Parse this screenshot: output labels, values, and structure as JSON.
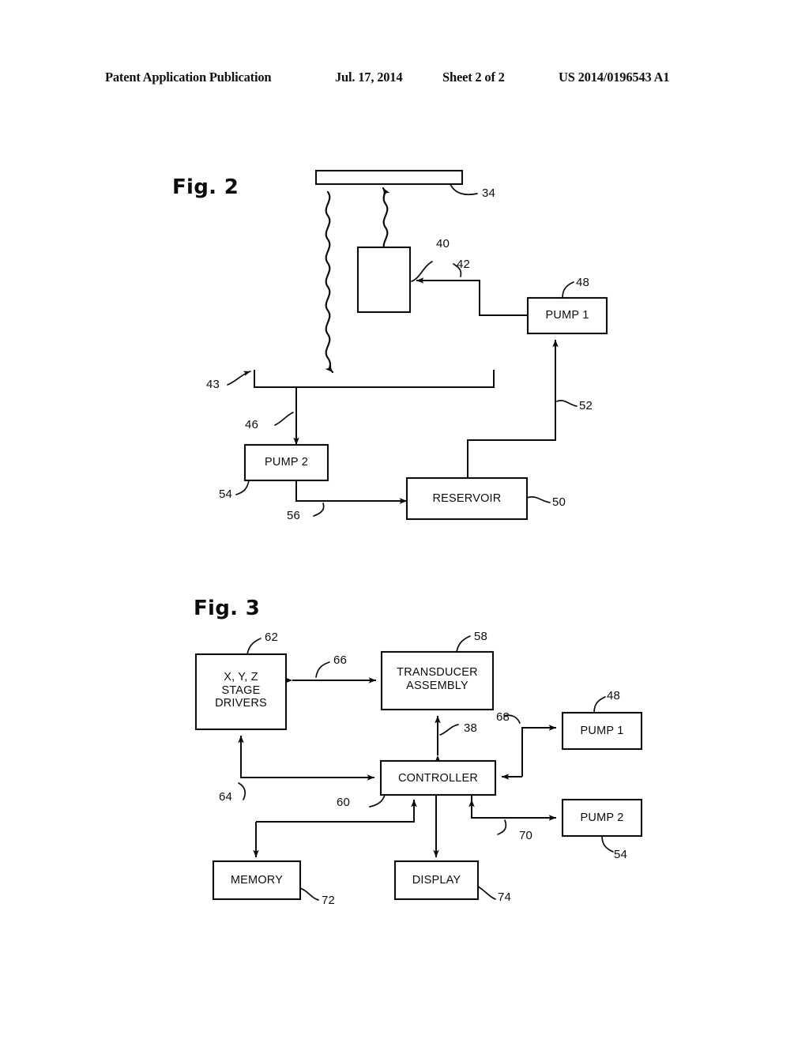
{
  "page": {
    "header": {
      "publication": "Patent Application Publication",
      "date": "Jul. 17, 2014",
      "sheet": "Sheet 2 of 2",
      "document_number": "US 2014/0196543 A1"
    },
    "ink_color": "#0d0d0d",
    "background_color": "#ffffff"
  },
  "figures": [
    {
      "label": "Fig. 2",
      "boxes": [
        {
          "id": "plate",
          "text": "",
          "ref": "34"
        },
        {
          "id": "transducer",
          "text": "",
          "ref": "40"
        },
        {
          "id": "pump1",
          "text": "PUMP 1",
          "ref": "48"
        },
        {
          "id": "pump2",
          "text": "PUMP 2",
          "ref": "54"
        },
        {
          "id": "reservoir",
          "text": "RESERVOIR",
          "ref": "50"
        }
      ],
      "refs": [
        "34",
        "40",
        "42",
        "48",
        "43",
        "52",
        "46",
        "54",
        "56",
        "50"
      ]
    },
    {
      "label": "Fig. 3",
      "boxes": [
        {
          "id": "stage-drivers",
          "text": "X, Y, Z\nSTAGE\nDRIVERS",
          "ref": "62"
        },
        {
          "id": "transducer-assembly",
          "text": "TRANSDUCER\nASSEMBLY",
          "ref": "58"
        },
        {
          "id": "controller",
          "text": "CONTROLLER",
          "ref": "60"
        },
        {
          "id": "pump1",
          "text": "PUMP 1",
          "ref": "48"
        },
        {
          "id": "pump2",
          "text": "PUMP 2",
          "ref": "54"
        },
        {
          "id": "memory",
          "text": "MEMORY",
          "ref": "72"
        },
        {
          "id": "display",
          "text": "DISPLAY",
          "ref": "74"
        }
      ],
      "refs": [
        "62",
        "66",
        "58",
        "48",
        "38",
        "68",
        "64",
        "60",
        "70",
        "54",
        "72",
        "74"
      ]
    }
  ],
  "fig2": {
    "label": "Fig. 2",
    "plate_ref": "34",
    "transducer_ref": "40",
    "line42_ref": "42",
    "pump1_label": "PUMP 1",
    "pump1_ref": "48",
    "container_ref": "43",
    "line52_ref": "52",
    "line46_ref": "46",
    "pump2_label": "PUMP 2",
    "pump2_ref": "54",
    "line56_ref": "56",
    "reservoir_label": "RESERVOIR",
    "reservoir_ref": "50"
  },
  "fig3": {
    "label": "Fig. 3",
    "stage_drivers_label": "X, Y, Z\nSTAGE\nDRIVERS",
    "stage_drivers_ref": "62",
    "link66_ref": "66",
    "transducer_assembly_label": "TRANSDUCER\nASSEMBLY",
    "transducer_assembly_ref": "58",
    "link38_ref": "38",
    "link68_ref": "68",
    "pump1_label": "PUMP 1",
    "pump1_ref": "48",
    "link64_ref": "64",
    "controller_label": "CONTROLLER",
    "controller_ref": "60",
    "link70_ref": "70",
    "pump2_label": "PUMP 2",
    "pump2_ref": "54",
    "memory_label": "MEMORY",
    "memory_ref": "72",
    "display_label": "DISPLAY",
    "display_ref": "74"
  }
}
